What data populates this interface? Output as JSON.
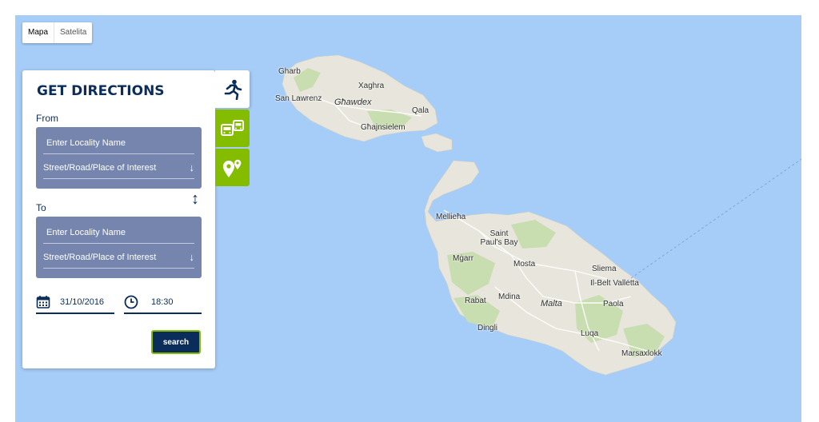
{
  "map_type": {
    "map": "Mapa",
    "satellite": "Satelita"
  },
  "panel": {
    "title": "GET DIRECTIONS",
    "from_label": "From",
    "to_label": "To",
    "from": {
      "locality_placeholder": "Enter Locality Name",
      "street_placeholder": "Street/Road/Place of Interest"
    },
    "to": {
      "locality_placeholder": "Enter Locality Name",
      "street_placeholder": "Street/Road/Place of Interest"
    },
    "date": "31/10/2016",
    "time": "18:30",
    "search_label": "search"
  },
  "tabs": {
    "walk": "walking-icon",
    "bus": "bus-icon",
    "poi": "place-pins-icon"
  },
  "places": [
    {
      "id": "gharb",
      "label": "Gharb"
    },
    {
      "id": "xaghra",
      "label": "Xaghra"
    },
    {
      "id": "san-lawrenz",
      "label": "San Lawrenz"
    },
    {
      "id": "ghawdex",
      "label": "Għawdex"
    },
    {
      "id": "qala",
      "label": "Qala"
    },
    {
      "id": "ghajnsielem",
      "label": "Għajnsielem"
    },
    {
      "id": "mellieha",
      "label": "Mellieħa"
    },
    {
      "id": "st-pauls-bay",
      "label": "Saint Paul's Bay"
    },
    {
      "id": "mgarr",
      "label": "Mġarr"
    },
    {
      "id": "mosta",
      "label": "Mosta"
    },
    {
      "id": "sliema",
      "label": "Sliema"
    },
    {
      "id": "valletta",
      "label": "Il-Belt Valletta"
    },
    {
      "id": "rabat",
      "label": "Rabat"
    },
    {
      "id": "mdina",
      "label": "Mdina"
    },
    {
      "id": "malta",
      "label": "Malta"
    },
    {
      "id": "paola",
      "label": "Paola"
    },
    {
      "id": "dingli",
      "label": "Dingli"
    },
    {
      "id": "luqa",
      "label": "Luqa"
    },
    {
      "id": "marsaxlokk",
      "label": "Marsaxlokk"
    }
  ],
  "colors": {
    "sea": "#a6cdf8",
    "land": "#e8e6dc",
    "park": "#c9deb0",
    "navy": "#0b2d5b",
    "green": "#84bd00",
    "field_box": "#7585ae"
  }
}
